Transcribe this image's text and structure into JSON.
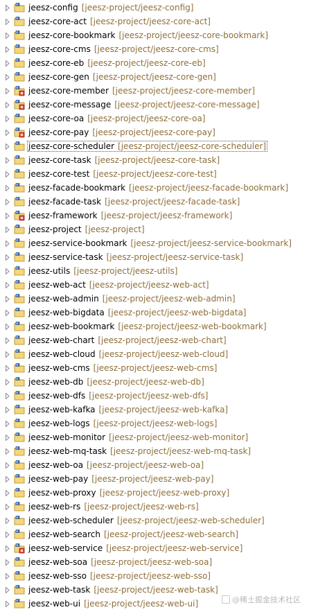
{
  "projects": [
    {
      "name": "jeesz-config",
      "path": "[jeesz-project/jeesz-config]",
      "badge": false,
      "selected": false
    },
    {
      "name": "jeesz-core-act",
      "path": "[jeesz-project/jeesz-core-act]",
      "badge": false,
      "selected": false
    },
    {
      "name": "jeesz-core-bookmark",
      "path": "[jeesz-project/jeesz-core-bookmark]",
      "badge": false,
      "selected": false
    },
    {
      "name": "jeesz-core-cms",
      "path": "[jeesz-project/jeesz-core-cms]",
      "badge": false,
      "selected": false
    },
    {
      "name": "jeesz-core-eb",
      "path": "[jeesz-project/jeesz-core-eb]",
      "badge": false,
      "selected": false
    },
    {
      "name": "jeesz-core-gen",
      "path": "[jeesz-project/jeesz-core-gen]",
      "badge": false,
      "selected": false
    },
    {
      "name": "jeesz-core-member",
      "path": "[jeesz-project/jeesz-core-member]",
      "badge": true,
      "selected": false
    },
    {
      "name": "jeesz-core-message",
      "path": "[jeesz-project/jeesz-core-message]",
      "badge": true,
      "selected": false
    },
    {
      "name": "jeesz-core-oa",
      "path": "[jeesz-project/jeesz-core-oa]",
      "badge": false,
      "selected": false
    },
    {
      "name": "jeesz-core-pay",
      "path": "[jeesz-project/jeesz-core-pay]",
      "badge": true,
      "selected": false
    },
    {
      "name": "jeesz-core-scheduler",
      "path": "[jeesz-project/jeesz-core-scheduler]",
      "badge": false,
      "selected": true
    },
    {
      "name": "jeesz-core-task",
      "path": "[jeesz-project/jeesz-core-task]",
      "badge": false,
      "selected": false
    },
    {
      "name": "jeesz-core-test",
      "path": "[jeesz-project/jeesz-core-test]",
      "badge": false,
      "selected": false
    },
    {
      "name": "jeesz-facade-bookmark",
      "path": "[jeesz-project/jeesz-facade-bookmark]",
      "badge": false,
      "selected": false
    },
    {
      "name": "jeesz-facade-task",
      "path": "[jeesz-project/jeesz-facade-task]",
      "badge": false,
      "selected": false
    },
    {
      "name": "jeesz-framework",
      "path": "[jeesz-project/jeesz-framework]",
      "badge": true,
      "selected": false
    },
    {
      "name": "jeesz-project",
      "path": "[jeesz-project]",
      "badge": false,
      "selected": false
    },
    {
      "name": "jeesz-service-bookmark",
      "path": "[jeesz-project/jeesz-service-bookmark]",
      "badge": false,
      "selected": false
    },
    {
      "name": "jeesz-service-task",
      "path": "[jeesz-project/jeesz-service-task]",
      "badge": false,
      "selected": false
    },
    {
      "name": "jeesz-utils",
      "path": "[jeesz-project/jeesz-utils]",
      "badge": false,
      "selected": false
    },
    {
      "name": "jeesz-web-act",
      "path": "[jeesz-project/jeesz-web-act]",
      "badge": false,
      "selected": false
    },
    {
      "name": "jeesz-web-admin",
      "path": "[jeesz-project/jeesz-web-admin]",
      "badge": false,
      "selected": false
    },
    {
      "name": "jeesz-web-bigdata",
      "path": "[jeesz-project/jeesz-web-bigdata]",
      "badge": false,
      "selected": false
    },
    {
      "name": "jeesz-web-bookmark",
      "path": "[jeesz-project/jeesz-web-bookmark]",
      "badge": false,
      "selected": false
    },
    {
      "name": "jeesz-web-chart",
      "path": "[jeesz-project/jeesz-web-chart]",
      "badge": false,
      "selected": false
    },
    {
      "name": "jeesz-web-cloud",
      "path": "[jeesz-project/jeesz-web-cloud]",
      "badge": false,
      "selected": false
    },
    {
      "name": "jeesz-web-cms",
      "path": "[jeesz-project/jeesz-web-cms]",
      "badge": false,
      "selected": false
    },
    {
      "name": "jeesz-web-db",
      "path": "[jeesz-project/jeesz-web-db]",
      "badge": false,
      "selected": false
    },
    {
      "name": "jeesz-web-dfs",
      "path": "[jeesz-project/jeesz-web-dfs]",
      "badge": false,
      "selected": false
    },
    {
      "name": "jeesz-web-kafka",
      "path": "[jeesz-project/jeesz-web-kafka]",
      "badge": false,
      "selected": false
    },
    {
      "name": "jeesz-web-logs",
      "path": "[jeesz-project/jeesz-web-logs]",
      "badge": false,
      "selected": false
    },
    {
      "name": "jeesz-web-monitor",
      "path": "[jeesz-project/jeesz-web-monitor]",
      "badge": false,
      "selected": false
    },
    {
      "name": "jeesz-web-mq-task",
      "path": "[jeesz-project/jeesz-web-mq-task]",
      "badge": false,
      "selected": false
    },
    {
      "name": "jeesz-web-oa",
      "path": "[jeesz-project/jeesz-web-oa]",
      "badge": false,
      "selected": false
    },
    {
      "name": "jeesz-web-pay",
      "path": "[jeesz-project/jeesz-web-pay]",
      "badge": false,
      "selected": false
    },
    {
      "name": "jeesz-web-proxy",
      "path": "[jeesz-project/jeesz-web-proxy]",
      "badge": false,
      "selected": false
    },
    {
      "name": "jeesz-web-rs",
      "path": "[jeesz-project/jeesz-web-rs]",
      "badge": false,
      "selected": false
    },
    {
      "name": "jeesz-web-scheduler",
      "path": "[jeesz-project/jeesz-web-scheduler]",
      "badge": false,
      "selected": false
    },
    {
      "name": "jeesz-web-search",
      "path": "[jeesz-project/jeesz-web-search]",
      "badge": false,
      "selected": false
    },
    {
      "name": "jeesz-web-service",
      "path": "[jeesz-project/jeesz-web-service]",
      "badge": true,
      "selected": false
    },
    {
      "name": "jeesz-web-soa",
      "path": "[jeesz-project/jeesz-web-soa]",
      "badge": false,
      "selected": false
    },
    {
      "name": "jeesz-web-sso",
      "path": "[jeesz-project/jeesz-web-sso]",
      "badge": false,
      "selected": false
    },
    {
      "name": "jeesz-web-task",
      "path": "[jeesz-project/jeesz-web-task]",
      "badge": false,
      "selected": false
    },
    {
      "name": "jeesz-web-ui",
      "path": "[jeesz-project/jeesz-web-ui]",
      "badge": false,
      "selected": false
    }
  ],
  "watermark": {
    "text": "@稀土掘金技术社区"
  },
  "icons": {
    "expand": "chevron-right-icon",
    "project": "maven-project-icon",
    "badge": "error-badge-icon"
  },
  "colors": {
    "name": "#000000",
    "path": "#8e6f3a",
    "folder": "#e8c255",
    "badge": "#d9342b"
  }
}
